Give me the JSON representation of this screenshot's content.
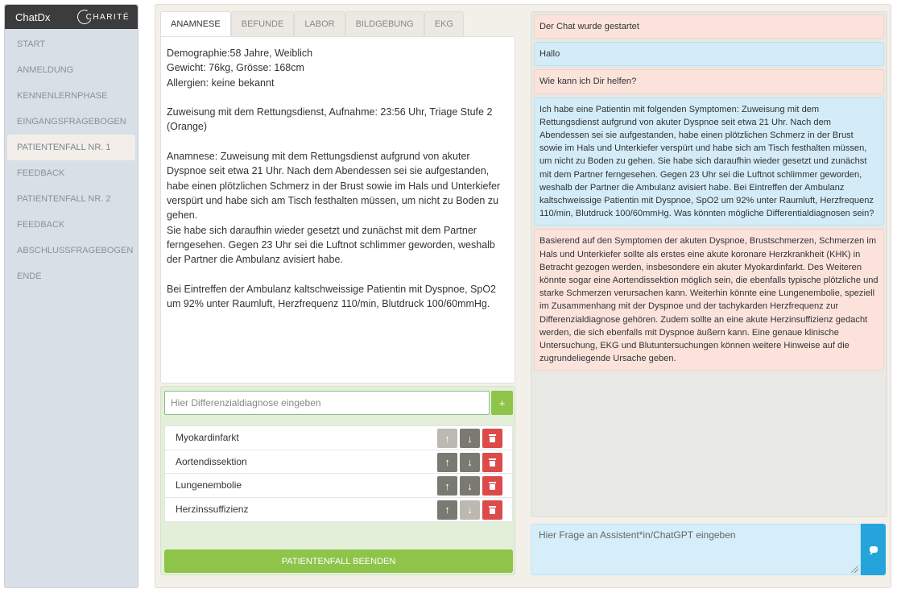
{
  "app": {
    "brand": "ChatDx",
    "logo_text": "CHARITÉ"
  },
  "sidebar": {
    "items": [
      {
        "label": "START"
      },
      {
        "label": "ANMELDUNG"
      },
      {
        "label": "KENNENLERNPHASE"
      },
      {
        "label": "EINGANGSFRAGEBOGEN"
      },
      {
        "label": "PATIENTENFALL NR. 1",
        "active": true
      },
      {
        "label": "FEEDBACK"
      },
      {
        "label": "PATIENTENFALL NR. 2"
      },
      {
        "label": "FEEDBACK"
      },
      {
        "label": "ABSCHLUSSFRAGEBOGEN"
      },
      {
        "label": "ENDE"
      }
    ]
  },
  "tabs": [
    {
      "label": "ANAMNESE",
      "active": true
    },
    {
      "label": "BEFUNDE"
    },
    {
      "label": "LABOR"
    },
    {
      "label": "BILDGEBUNG"
    },
    {
      "label": "EKG"
    }
  ],
  "case": {
    "p1_l1": "Demographie:58 Jahre, Weiblich",
    "p1_l2": "Gewicht: 76kg, Grösse: 168cm",
    "p1_l3": "Allergien: keine bekannt",
    "p2": "Zuweisung mit dem Rettungsdienst, Aufnahme: 23:56 Uhr, Triage Stufe 2 (Orange)",
    "p3_a": "Anamnese: Zuweisung mit dem Rettungsdienst aufgrund von akuter Dyspnoe seit etwa 21 Uhr. Nach dem Abendessen sei sie aufgestanden, habe einen plötzlichen Schmerz in der Brust sowie im Hals und Unterkiefer verspürt und habe sich am Tisch festhalten müssen, um nicht zu Boden zu gehen.",
    "p3_b": "Sie habe sich daraufhin wieder gesetzt und zunächst mit dem Partner ferngesehen. Gegen 23 Uhr sei die Luftnot schlimmer geworden, weshalb der Partner die Ambulanz avisiert habe.",
    "p4": "Bei Eintreffen der Ambulanz kaltschweissige Patientin mit Dyspnoe, SpO2 um 92% unter Raumluft, Herzfrequenz 110/min, Blutdruck 100/60mmHg."
  },
  "diagnosis": {
    "input_placeholder": "Hier Differenzialdiagnose eingeben",
    "add_label": "+",
    "items": [
      {
        "label": "Myokardinfarkt",
        "up_disabled": true,
        "down_disabled": false
      },
      {
        "label": "Aortendissektion",
        "up_disabled": false,
        "down_disabled": false
      },
      {
        "label": "Lungenembolie",
        "up_disabled": false,
        "down_disabled": false
      },
      {
        "label": "Herzinssuffizienz",
        "up_disabled": false,
        "down_disabled": true
      }
    ],
    "up_symbol": "↑",
    "down_symbol": "↓",
    "end_label": "PATIENTENFALL BEENDEN"
  },
  "chat": {
    "messages": [
      {
        "role": "bot",
        "text": "Der Chat wurde gestartet"
      },
      {
        "role": "user",
        "text": "Hallo"
      },
      {
        "role": "bot",
        "text": "Wie kann ich Dir helfen?"
      },
      {
        "role": "user",
        "text": "Ich habe eine Patientin mit folgenden Symptomen: Zuweisung mit dem Rettungsdienst aufgrund von akuter Dyspnoe seit etwa 21 Uhr. Nach dem Abendessen sei sie aufgestanden, habe einen plötzlichen Schmerz in der Brust sowie im Hals und Unterkiefer verspürt und habe sich am Tisch festhalten müssen, um nicht zu Boden zu gehen. Sie habe sich daraufhin wieder gesetzt und zunächst mit dem Partner ferngesehen. Gegen 23 Uhr sei die Luftnot schlimmer geworden, weshalb der Partner die Ambulanz avisiert habe. Bei Eintreffen der Ambulanz kaltschweissige Patientin mit Dyspnoe, SpO2 um 92% unter Raumluft, Herzfrequenz 110/min, Blutdruck 100/60mmHg. Was könnten mögliche Differentialdiagnosen sein?"
      },
      {
        "role": "bot",
        "text": "Basierend auf den Symptomen der akuten Dyspnoe, Brustschmerzen, Schmerzen im Hals und Unterkiefer sollte als erstes eine akute koronare Herzkrankheit (KHK) in Betracht gezogen werden, insbesondere ein akuter Myokardinfarkt. Des Weiteren könnte sogar eine Aortendissektion möglich sein, die ebenfalls typische plötzliche und starke Schmerzen verursachen kann. Weiterhin könnte eine Lungenembolie, speziell im Zusammenhang mit der Dyspnoe und der tachykarden Herzfrequenz zur Differenzialdiagnose gehören. Zudem sollte an eine akute Herzinsuffizienz gedacht werden, die sich ebenfalls mit Dyspnoe äußern kann. Eine genaue klinische Untersuchung, EKG und Blutuntersuchungen können weitere Hinweise auf die zugrundeliegende Ursache geben."
      }
    ],
    "input_placeholder": "Hier Frage an Assistent*in/ChatGPT eingeben"
  }
}
